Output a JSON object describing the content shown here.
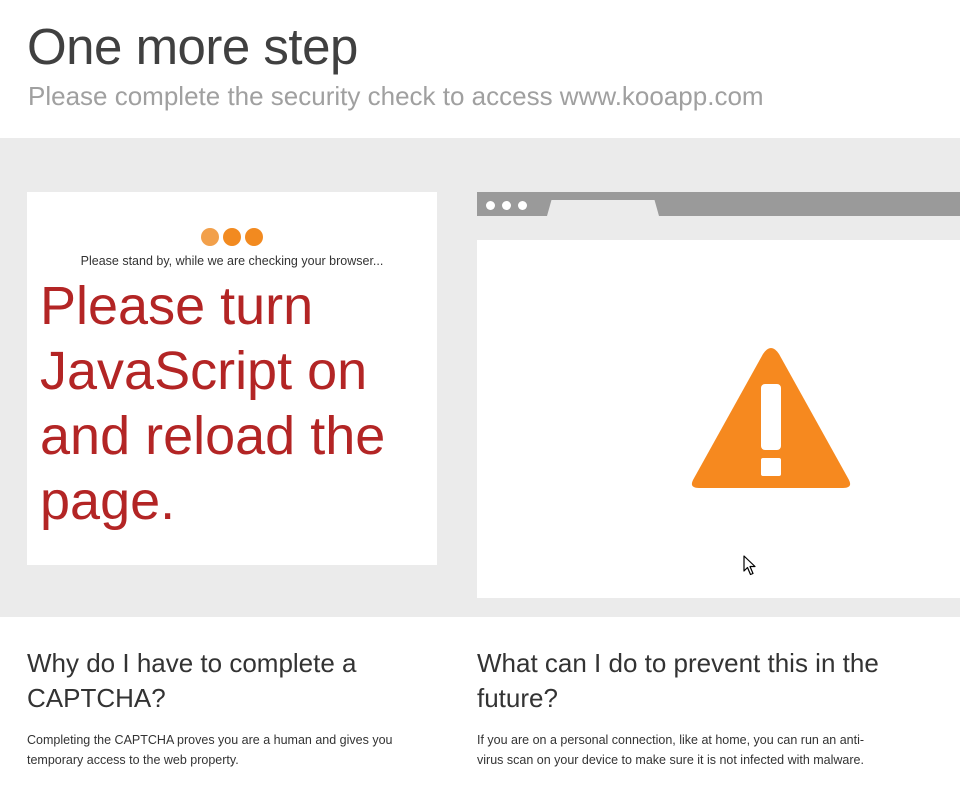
{
  "header": {
    "title": "One more step",
    "subtitle": "Please complete the security check to access www.kooapp.com"
  },
  "challenge": {
    "loading_dot_colors": [
      "#f2a04b",
      "#f28a20",
      "#f28a20"
    ],
    "standby_text": "Please stand by, while we are checking your browser...",
    "javascript_warning": "Please turn JavaScript on and reload the page."
  },
  "browser_illustration": {
    "warning_icon": "warning-triangle-icon",
    "warning_color": "#f6891f"
  },
  "info": {
    "why_heading": "Why do I have to complete a CAPTCHA?",
    "why_text": "Completing the CAPTCHA proves you are a human and gives you temporary access to the web property.",
    "prevent_heading": "What can I do to prevent this in the future?",
    "prevent_text": "If you are on a personal connection, like at home, you can run an anti-virus scan on your device to make sure it is not infected with malware."
  },
  "colors": {
    "band_background": "#ebebeb",
    "warning_text": "#b32525",
    "browser_bar": "#9a9a9a"
  }
}
